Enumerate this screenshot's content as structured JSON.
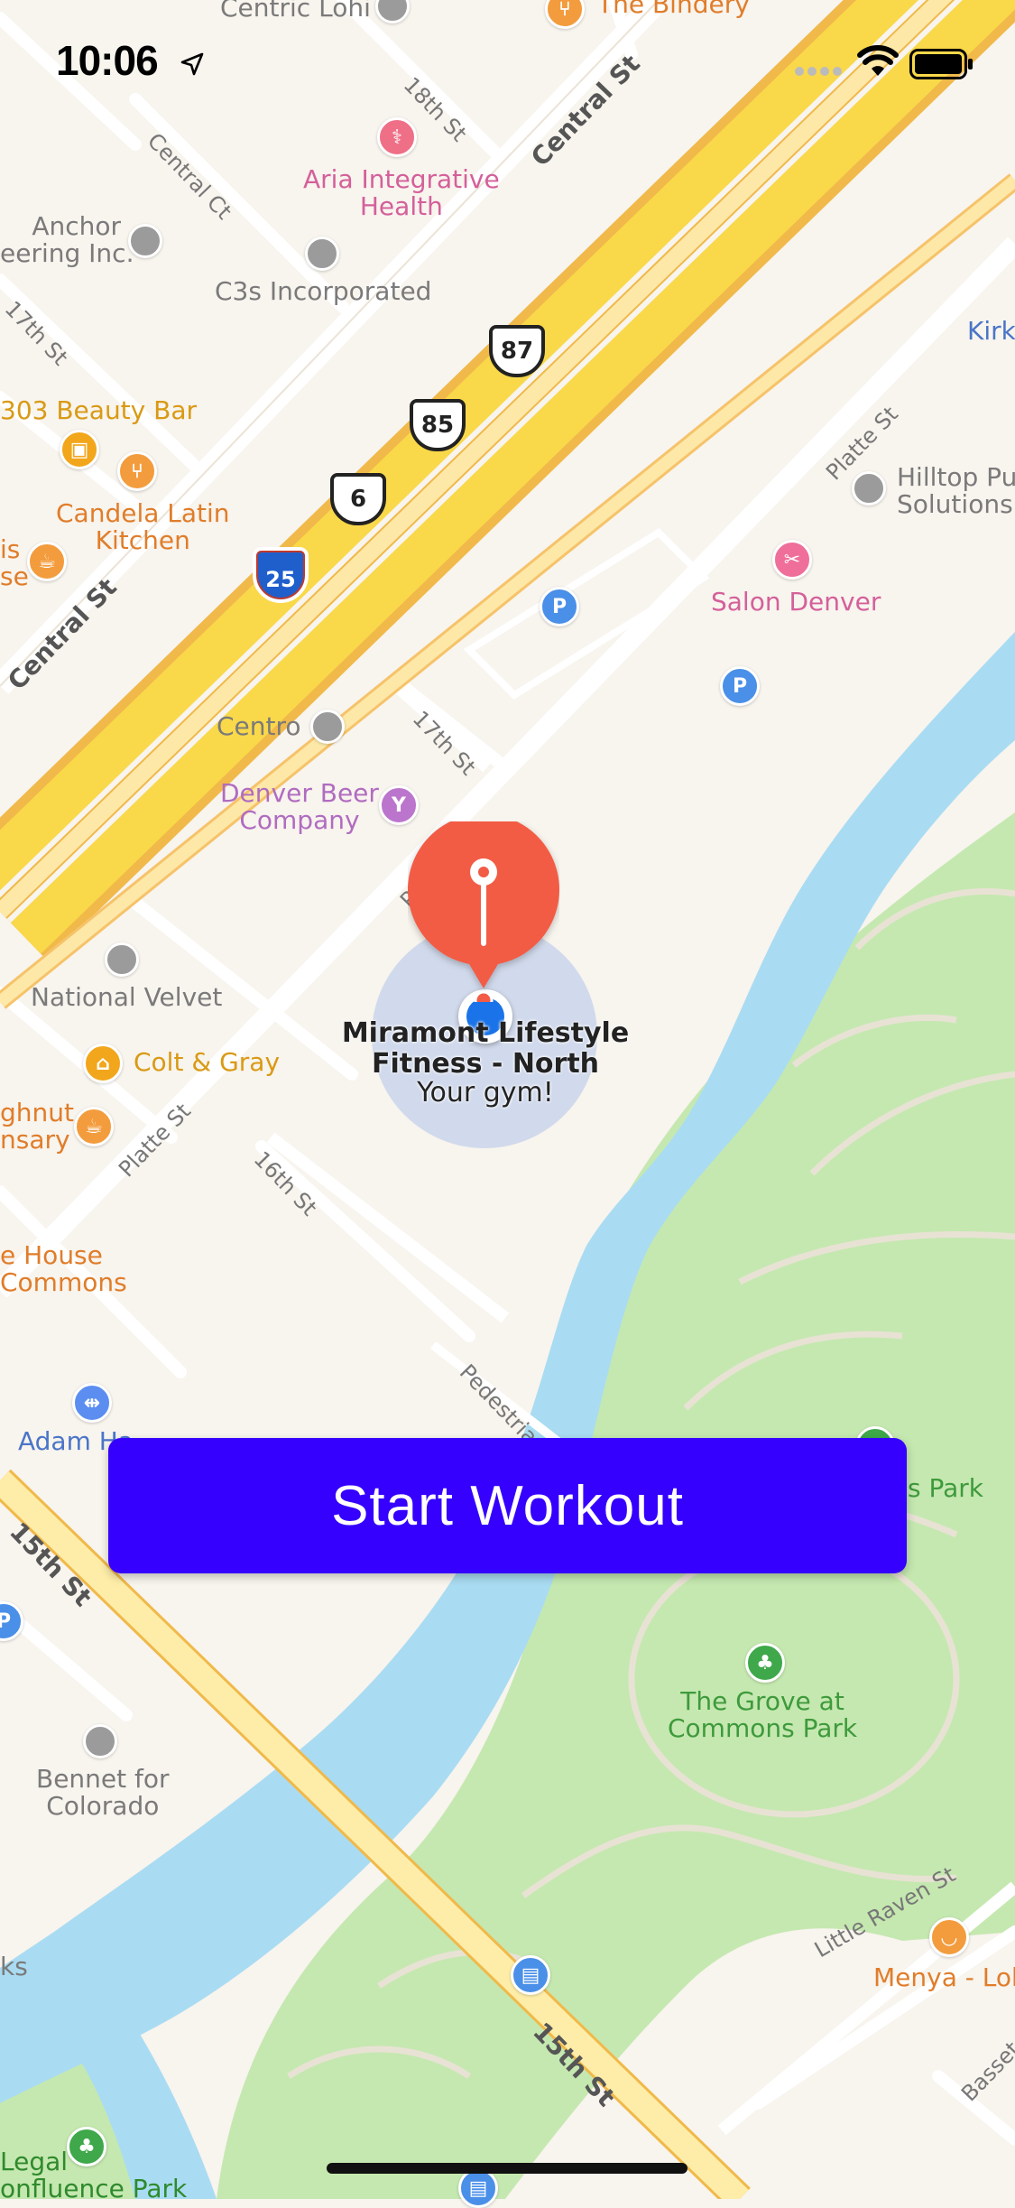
{
  "status_bar": {
    "time": "10:06",
    "icons": [
      "location-arrow-icon",
      "cellular-signal-icon",
      "wifi-icon",
      "battery-icon"
    ]
  },
  "map": {
    "colors": {
      "land": "#f8f4ee",
      "highway": "#f9d84a",
      "highway_edge": "#f0b94a",
      "river": "#a9dcf2",
      "park": "#c5e8b0",
      "road": "#ffffff",
      "arterial": "#fde8a8"
    },
    "places": [
      {
        "name": "Centric Lohi",
        "type": "point"
      },
      {
        "name": "The Bindery",
        "type": "food"
      },
      {
        "name": "Aria Integrative\nHealth",
        "type": "health"
      },
      {
        "name": "Anchor\neering Inc.",
        "type": "point"
      },
      {
        "name": "C3s Incorporated",
        "type": "point"
      },
      {
        "name": "303 Beauty Bar",
        "type": "shopping"
      },
      {
        "name": "Candela Latin\nKitchen",
        "type": "food"
      },
      {
        "name": "is\nse",
        "type": "cafe"
      },
      {
        "name": "Kirk",
        "type": "point"
      },
      {
        "name": "Hilltop Pu\nSolutions",
        "type": "point"
      },
      {
        "name": "Salon Denver",
        "type": "beauty"
      },
      {
        "name": "Centro",
        "type": "point"
      },
      {
        "name": "Denver Beer\nCompany",
        "type": "bar"
      },
      {
        "name": "National Velvet",
        "type": "point"
      },
      {
        "name": "Colt & Gray",
        "type": "food"
      },
      {
        "name": "ghnut\nnsary",
        "type": "cafe"
      },
      {
        "name": "e House\nCommons",
        "type": "point"
      },
      {
        "name": "Adam Ha",
        "type": "fitness"
      },
      {
        "name": "s Park",
        "type": "park"
      },
      {
        "name": "The Grove at\nCommons Park",
        "type": "park"
      },
      {
        "name": "Bennet for\nColorado",
        "type": "point"
      },
      {
        "name": "Menya - Loh",
        "type": "food"
      },
      {
        "name": "ks",
        "type": "point"
      },
      {
        "name": "Legal\nonfluence Park",
        "type": "park"
      }
    ],
    "streets": [
      "Central St",
      "18th St",
      "Central Ct",
      "17th St",
      "Central St",
      "Platte St",
      "17th St",
      "Platte St",
      "Platte St",
      "16th St",
      "Pedestria",
      "15th St",
      "Little Raven St",
      "15th St",
      "Basset"
    ],
    "route_shields": [
      "87",
      "85",
      "6",
      "25"
    ],
    "parking_label": "P"
  },
  "destination": {
    "name_line1": "Miramont Lifestyle",
    "name_line2": "Fitness - North",
    "subtitle": "Your gym!"
  },
  "actions": {
    "start_label": "Start Workout"
  }
}
